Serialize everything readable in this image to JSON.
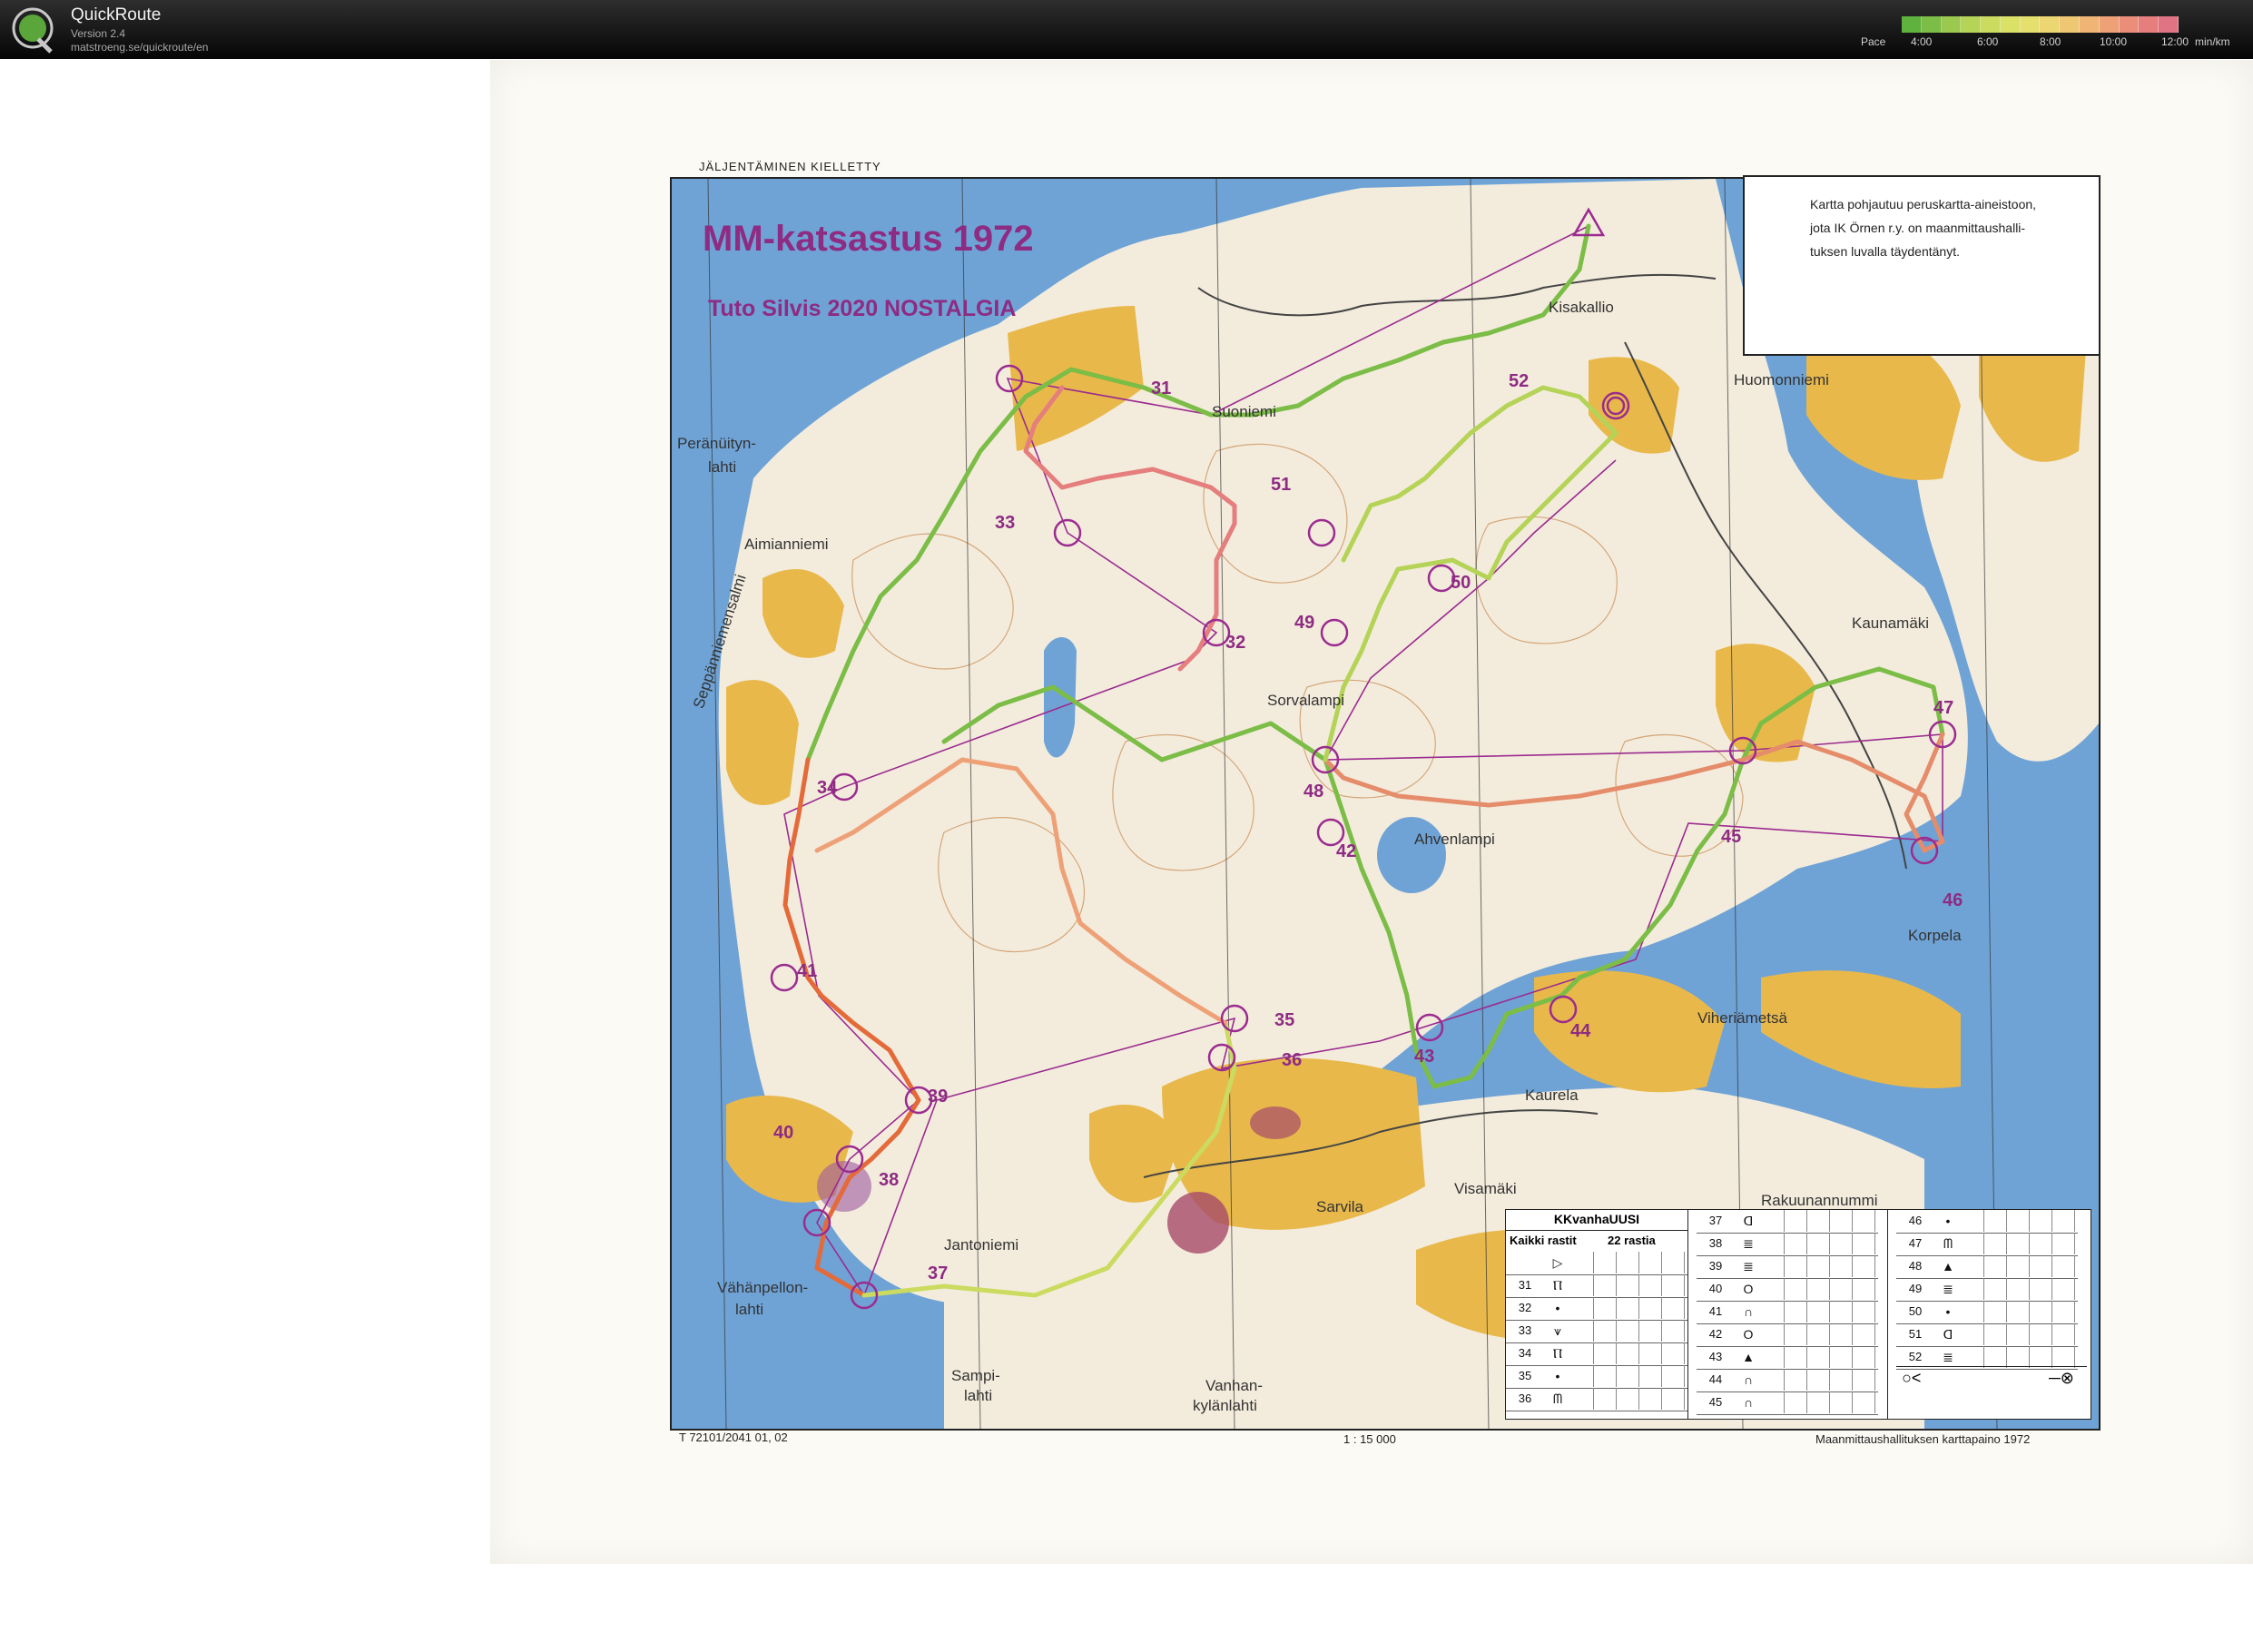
{
  "app": {
    "name": "QuickRoute",
    "version": "Version 2.4",
    "url": "matstroeng.se/quickroute/en"
  },
  "pace": {
    "label": "Pace",
    "ticks": [
      "4:00",
      "6:00",
      "8:00",
      "10:00",
      "12:00"
    ],
    "unit": "min/km",
    "colors": [
      "#5fb23d",
      "#7bbd46",
      "#9bc84e",
      "#b5d357",
      "#cbdb5f",
      "#dbe067",
      "#e5e06d",
      "#ecd671",
      "#efc772",
      "#f0b574",
      "#eea177",
      "#ea8e7a",
      "#e57e7d",
      "#e07485"
    ]
  },
  "map": {
    "header": "JÄLJENTÄMINEN KIELLETTY",
    "title": "MM-katsastus 1972",
    "subtitle": "Tuto Silvis 2020 NOSTALGIA",
    "info_lines": [
      "Kartta pohjautuu peruskartta-aineistoon,",
      "jota IK Örnen r.y. on maanmittaushalli-",
      "tuksen luvalla täydentänyt."
    ],
    "place_names": [
      "Kisakallio",
      "Huomonniemi",
      "Suoniemi",
      "Peränüityn-",
      "lahti",
      "Aimianniemi",
      "Sorvalampi",
      "Ahvenlampi",
      "Korpela",
      "Kaurela",
      "Sarvila",
      "Visamäki",
      "Jantoniemi",
      "Vähänpellon-",
      "lahti",
      "Sampi-",
      "lahti",
      "Vanhan-",
      "kylänlahti",
      "Viheriämetsä",
      "Kaunamäki",
      "Seppänniemensalmi",
      "Rakuunannummi"
    ],
    "controls": [
      "31",
      "32",
      "33",
      "34",
      "35",
      "36",
      "37",
      "38",
      "39",
      "40",
      "41",
      "42",
      "43",
      "44",
      "45",
      "46",
      "47",
      "48",
      "49",
      "50",
      "51",
      "52"
    ],
    "footer_left": "T 72101/2041 01, 02",
    "footer_mid": "1 : 15 000",
    "footer_right": "Maanmittaushallituksen karttapaino 1972"
  },
  "control_descriptions": {
    "course_name": "KKvanhaUUSI",
    "class_label": "Kaikki rastit",
    "count_label": "22 rastia",
    "col1": [
      {
        "num": "",
        "sym": "▷"
      },
      {
        "num": "31",
        "sym": "Ⲡ"
      },
      {
        "num": "32",
        "sym": "•"
      },
      {
        "num": "33",
        "sym": "⩛"
      },
      {
        "num": "34",
        "sym": "Ⲡ"
      },
      {
        "num": "35",
        "sym": "•"
      },
      {
        "num": "36",
        "sym": "ᗰ"
      }
    ],
    "col2": [
      {
        "num": "37",
        "sym": "ᗡ"
      },
      {
        "num": "38",
        "sym": "≣"
      },
      {
        "num": "39",
        "sym": "≣"
      },
      {
        "num": "40",
        "sym": "O"
      },
      {
        "num": "41",
        "sym": "∩"
      },
      {
        "num": "42",
        "sym": "O"
      },
      {
        "num": "43",
        "sym": "▲"
      },
      {
        "num": "44",
        "sym": "∩"
      },
      {
        "num": "45",
        "sym": "∩"
      }
    ],
    "col3": [
      {
        "num": "46",
        "sym": "•"
      },
      {
        "num": "47",
        "sym": "ᗰ"
      },
      {
        "num": "48",
        "sym": "▲"
      },
      {
        "num": "49",
        "sym": "≣"
      },
      {
        "num": "50",
        "sym": "•"
      },
      {
        "num": "51",
        "sym": "ᗡ"
      },
      {
        "num": "52",
        "sym": "≣"
      }
    ],
    "finish_left": "○<",
    "finish_right": "─⊗"
  }
}
